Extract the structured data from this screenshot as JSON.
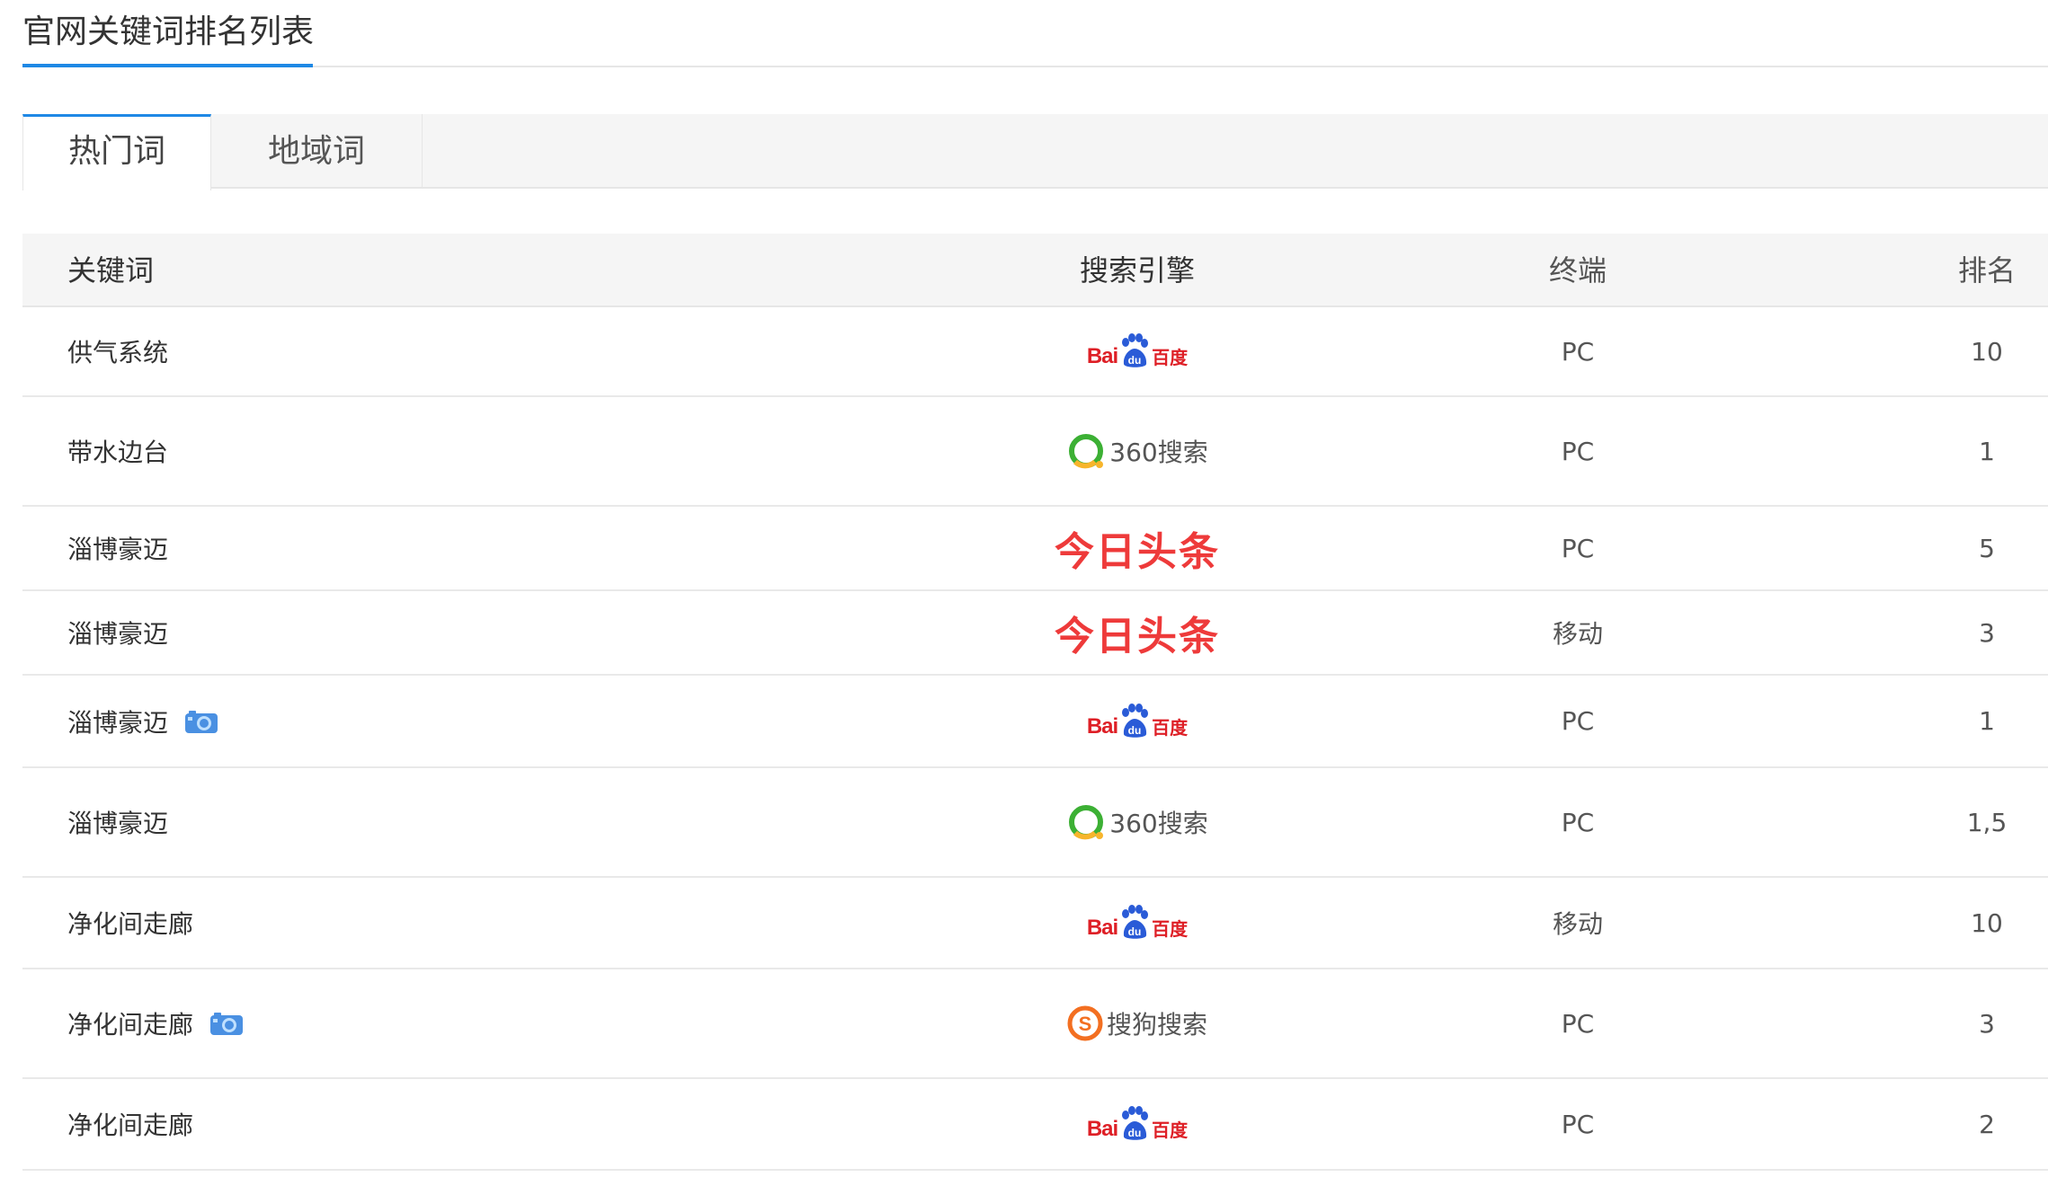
{
  "header": {
    "title": "官网关键词排名列表"
  },
  "tabs": [
    {
      "label": "热门词",
      "active": true
    },
    {
      "label": "地域词",
      "active": false
    }
  ],
  "table": {
    "columns": {
      "keyword": "关键词",
      "engine": "搜索引擎",
      "terminal": "终端",
      "rank": "排名"
    },
    "rows": [
      {
        "keyword": "供气系统",
        "camera": false,
        "engine": "baidu",
        "terminal": "PC",
        "rank": "10"
      },
      {
        "keyword": "带水边台",
        "camera": false,
        "engine": "360",
        "terminal": "PC",
        "rank": "1"
      },
      {
        "keyword": "淄博豪迈",
        "camera": false,
        "engine": "toutiao",
        "terminal": "PC",
        "rank": "5"
      },
      {
        "keyword": "淄博豪迈",
        "camera": false,
        "engine": "toutiao",
        "terminal": "移动",
        "rank": "3"
      },
      {
        "keyword": "淄博豪迈",
        "camera": true,
        "engine": "baidu",
        "terminal": "PC",
        "rank": "1"
      },
      {
        "keyword": "淄博豪迈",
        "camera": false,
        "engine": "360",
        "terminal": "PC",
        "rank": "1,5"
      },
      {
        "keyword": "净化间走廊",
        "camera": false,
        "engine": "baidu",
        "terminal": "移动",
        "rank": "10"
      },
      {
        "keyword": "净化间走廊",
        "camera": true,
        "engine": "sogou",
        "terminal": "PC",
        "rank": "3"
      },
      {
        "keyword": "净化间走廊",
        "camera": false,
        "engine": "baidu",
        "terminal": "PC",
        "rank": "2"
      }
    ]
  },
  "logos": {
    "baidu": {
      "bai": "Bai",
      "du": "百度",
      "color": "#de1f26",
      "paw_color": "#2a5bd7"
    },
    "360": {
      "text": "360搜索",
      "ring_color": "#3cb034",
      "accent": "#f7b52c"
    },
    "toutiao": {
      "text": "今日头条",
      "color": "#ee3a3a"
    },
    "sogou": {
      "text": "搜狗搜索",
      "color": "#f36f21"
    }
  },
  "icons": {
    "camera": "camera-icon"
  },
  "colors": {
    "accent": "#1e88e5",
    "header_bg": "#f5f5f5",
    "border": "#e6e6e6"
  }
}
